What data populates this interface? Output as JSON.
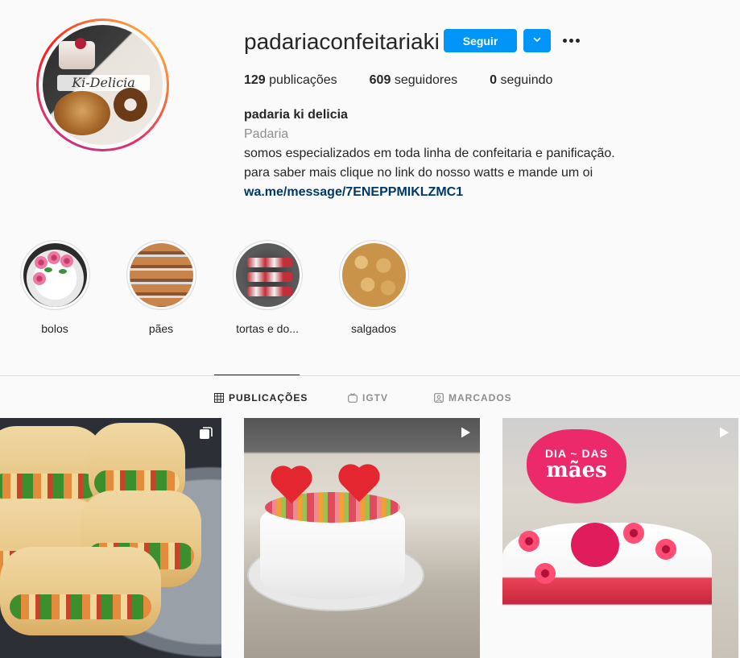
{
  "profile": {
    "username": "padariaconfeitariaki",
    "avatar_text": "Ki-Delicia",
    "follow_label": "Seguir",
    "stats": {
      "posts_count": "129",
      "posts_label": "publicações",
      "followers_count": "609",
      "followers_label": "seguidores",
      "following_count": "0",
      "following_label": "seguindo"
    },
    "bio": {
      "name": "padaria ki delicia",
      "category": "Padaria",
      "line1": "somos especializados em toda linha de confeitaria e panificação.",
      "line2": "para saber mais clique no link do nosso watts e mande um oi",
      "link": "wa.me/message/7ENEPPMIKLZMC1"
    }
  },
  "highlights": [
    {
      "label": "bolos"
    },
    {
      "label": "pães"
    },
    {
      "label": "tortas e do..."
    },
    {
      "label": "salgados"
    }
  ],
  "tabs": [
    {
      "label": "PUBLICAÇÕES",
      "icon": "grid-icon",
      "active": true
    },
    {
      "label": "IGTV",
      "icon": "igtv-icon",
      "active": false
    },
    {
      "label": "MARCADOS",
      "icon": "tagged-icon",
      "active": false
    }
  ],
  "posts": [
    {
      "type_icon": "carousel-icon",
      "subject": "wraps"
    },
    {
      "type_icon": "video-icon",
      "subject": "cake with hearts"
    },
    {
      "type_icon": "video-icon",
      "subject": "mothers day cake",
      "sign_line1": "DIA ~ DAS",
      "sign_line2": "mães"
    }
  ],
  "colors": {
    "accent": "#0095f6",
    "text": "#262626",
    "muted": "#8e8e8e",
    "link": "#00376b",
    "background": "#fafafa"
  }
}
